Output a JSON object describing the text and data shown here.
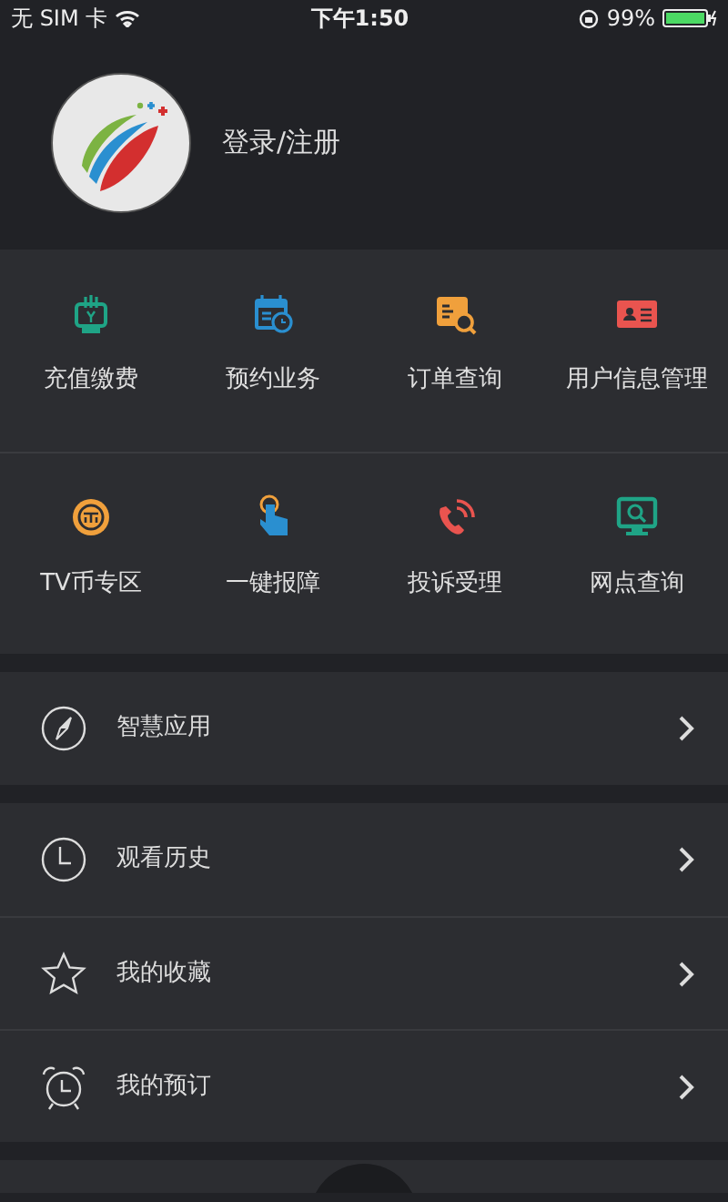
{
  "status_bar": {
    "carrier": "无 SIM 卡",
    "time": "下午1:50",
    "battery": "99%"
  },
  "profile": {
    "login_label": "登录/注册"
  },
  "services": [
    {
      "kind": "recharge",
      "label": "充值缴费",
      "color": "#1fa486"
    },
    {
      "kind": "booking",
      "label": "预约业务",
      "color": "#2a8fd0"
    },
    {
      "kind": "order",
      "label": "订单查询",
      "color": "#f0a03c"
    },
    {
      "kind": "user",
      "label": "用户信息管理",
      "color": "#e9544f"
    },
    {
      "kind": "coin",
      "label": "TV币专区",
      "color": "#f0a03c"
    },
    {
      "kind": "repair",
      "label": "一键报障",
      "color": "#2a8fd0"
    },
    {
      "kind": "complaint",
      "label": "投诉受理",
      "color": "#e9544f"
    },
    {
      "kind": "outlet",
      "label": "网点查询",
      "color": "#1fa486"
    }
  ],
  "menu_groups": [
    [
      {
        "kind": "compass",
        "label": "智慧应用"
      }
    ],
    [
      {
        "kind": "clock",
        "label": "观看历史"
      },
      {
        "kind": "star",
        "label": "我的收藏"
      },
      {
        "kind": "alarm",
        "label": "我的预订"
      }
    ]
  ]
}
